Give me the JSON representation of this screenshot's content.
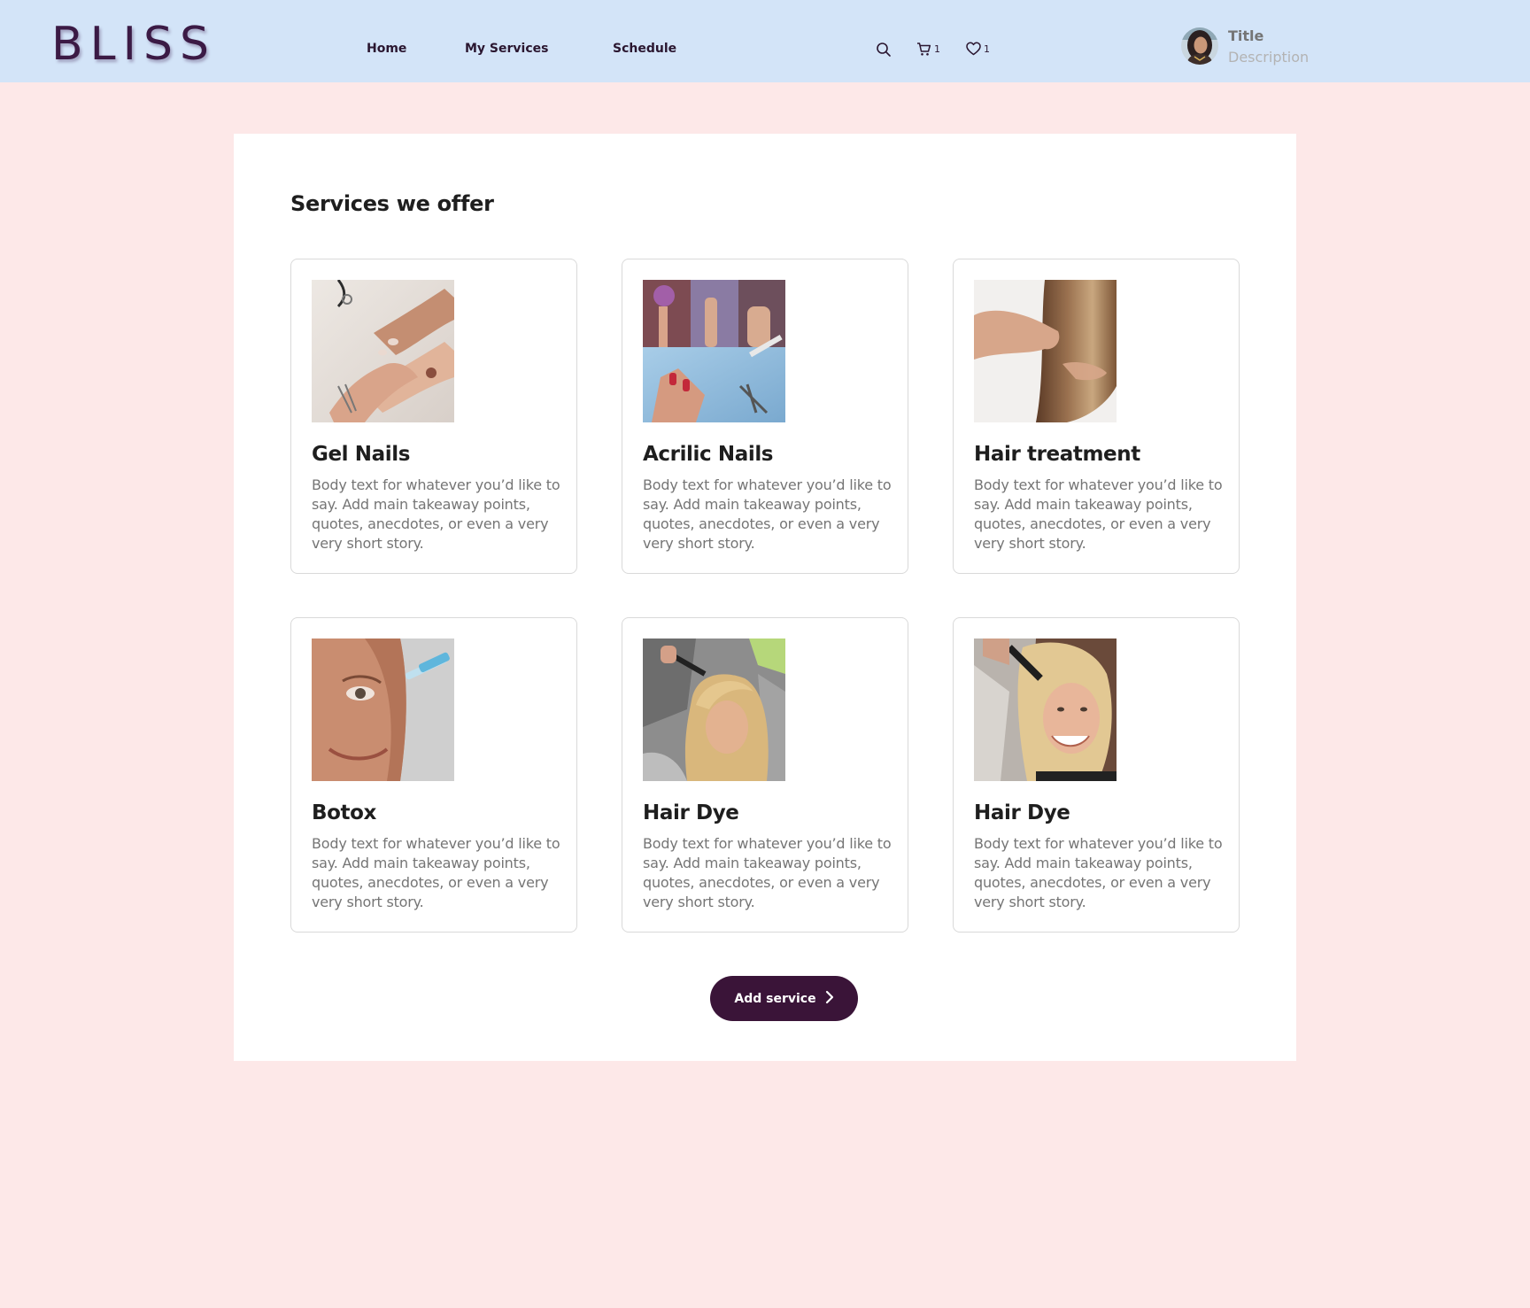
{
  "header": {
    "logo": "BLISS",
    "nav": [
      {
        "label": "Home"
      },
      {
        "label": "My Services"
      },
      {
        "label": "Schedule"
      }
    ],
    "icons": {
      "search": "search-icon",
      "cart": {
        "icon": "cart-icon",
        "count": "1"
      },
      "favorites": {
        "icon": "heart-icon",
        "count": "1"
      }
    },
    "profile": {
      "title": "Title",
      "description": "Description"
    }
  },
  "main": {
    "section_title": "Services we offer",
    "services": [
      {
        "title": "Gel Nails",
        "body": "Body text for whatever you’d like to say. Add main takeaway points, quotes, anecdotes, or even a very very short story."
      },
      {
        "title": "Acrilic Nails",
        "body": "Body text for whatever you’d like to say. Add main takeaway points, quotes, anecdotes, or even a very very short story."
      },
      {
        "title": "Hair treatment",
        "body": "Body text for whatever you’d like to say. Add main takeaway points, quotes, anecdotes, or even a very very short story."
      },
      {
        "title": "Botox",
        "body": "Body text for whatever you’d like to say. Add main takeaway points, quotes, anecdotes, or even a very very short story."
      },
      {
        "title": "Hair Dye",
        "body": "Body text for whatever you’d like to say. Add main takeaway points, quotes, anecdotes, or even a very very short story."
      },
      {
        "title": "Hair Dye",
        "body": "Body text for whatever you’d like to say. Add main takeaway points, quotes, anecdotes, or even a very very short story."
      }
    ],
    "add_button": {
      "label": "Add service",
      "icon": "chevron-right-icon"
    }
  },
  "colors": {
    "header_bg": "#d3e4f8",
    "page_bg": "#fde8e8",
    "brand": "#3a1438",
    "card_border": "#d9d9d9"
  }
}
